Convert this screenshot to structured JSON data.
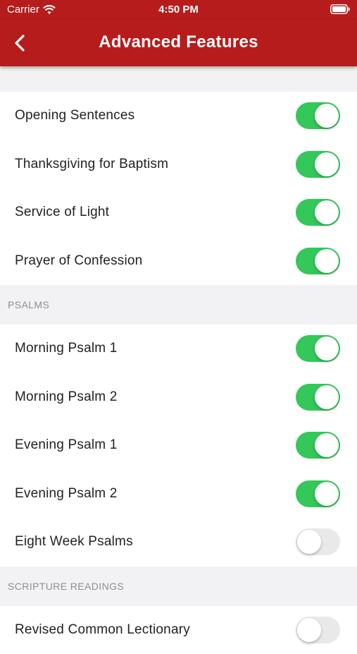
{
  "status_bar": {
    "carrier": "Carrier",
    "time": "4:50 PM"
  },
  "nav": {
    "title": "Advanced Features",
    "back_icon": "chevron-left-icon"
  },
  "colors": {
    "brand": "#b71c1c",
    "toggle_on": "#34c759",
    "toggle_off": "#e9e9ea"
  },
  "groups": {
    "general": {
      "items": [
        {
          "label": "Opening Sentences",
          "on": true
        },
        {
          "label": "Thanksgiving for Baptism",
          "on": true
        },
        {
          "label": "Service of Light",
          "on": true
        },
        {
          "label": "Prayer of Confession",
          "on": true
        }
      ]
    },
    "psalms": {
      "header": "PSALMS",
      "items": [
        {
          "label": "Morning Psalm 1",
          "on": true
        },
        {
          "label": "Morning Psalm 2",
          "on": true
        },
        {
          "label": "Evening Psalm 1",
          "on": true
        },
        {
          "label": "Evening Psalm 2",
          "on": true
        },
        {
          "label": "Eight Week Psalms",
          "on": false
        }
      ]
    },
    "scripture": {
      "header": "SCRIPTURE READINGS",
      "items": [
        {
          "label": "Revised Common Lectionary",
          "on": false
        }
      ]
    }
  }
}
